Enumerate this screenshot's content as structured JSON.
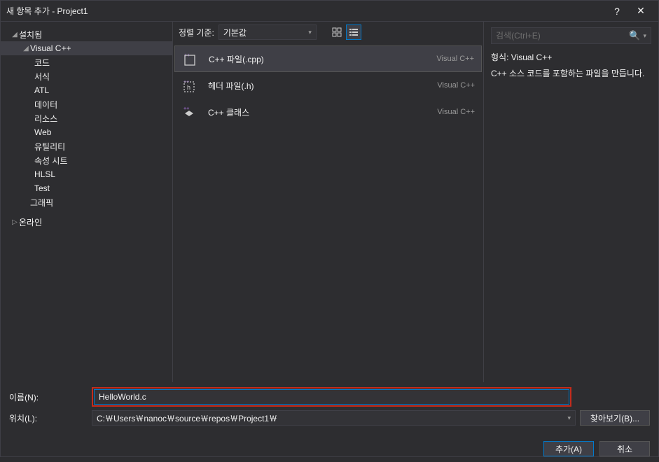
{
  "titlebar": {
    "title": "새 항목 추가 - Project1",
    "help": "?",
    "close": "✕"
  },
  "sidebar": {
    "installed": "설치됨",
    "vcpp": "Visual C++",
    "items": {
      "code": "코드",
      "format": "서식",
      "atl": "ATL",
      "data": "데이터",
      "resource": "리소스",
      "web": "Web",
      "utility": "유틸리티",
      "propsheet": "속성 시트",
      "hlsl": "HLSL",
      "test": "Test"
    },
    "graphic": "그래픽",
    "online": "온라인"
  },
  "toolbar": {
    "sort_label": "정렬 기준:",
    "sort_value": "기본값"
  },
  "templates": [
    {
      "label": "C++ 파일(.cpp)",
      "lang": "Visual C++"
    },
    {
      "label": "헤더 파일(.h)",
      "lang": "Visual C++"
    },
    {
      "label": "C++ 클래스",
      "lang": "Visual C++"
    }
  ],
  "search": {
    "placeholder": "검색(Ctrl+E)"
  },
  "details": {
    "title": "형식:  Visual C++",
    "desc": "C++ 소스 코드를 포함하는 파일을 만듭니다."
  },
  "form": {
    "name_label": "이름(N):",
    "name_value": "HelloWorld.c",
    "location_label": "위치(L):",
    "location_value": "C:￦Users￦nanoc￦source￦repos￦Project1￦",
    "browse": "찾아보기(B)..."
  },
  "buttons": {
    "add": "추가(A)",
    "cancel": "취소"
  }
}
